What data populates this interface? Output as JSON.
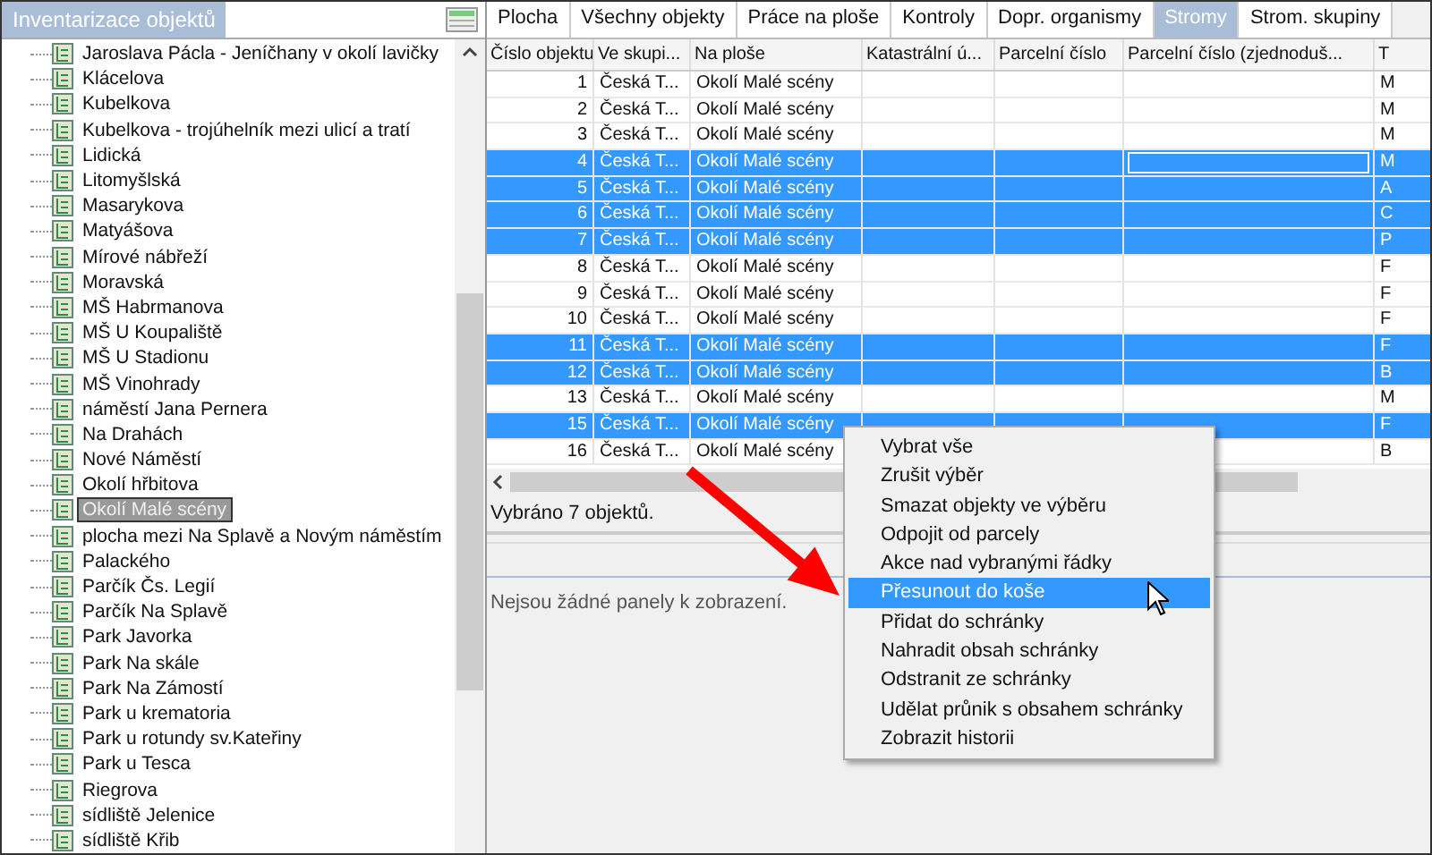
{
  "left_panel": {
    "title": "Inventarizace objektů",
    "tree_items": [
      {
        "label": "Jaroslava Pácla - Jeníčhany v okolí lavičky",
        "selected": false
      },
      {
        "label": "Klácelova",
        "selected": false
      },
      {
        "label": "Kubelkova",
        "selected": false
      },
      {
        "label": "Kubelkova - trojúhelník mezi ulicí a tratí",
        "selected": false
      },
      {
        "label": "Lidická",
        "selected": false
      },
      {
        "label": "Litomyšlská",
        "selected": false
      },
      {
        "label": "Masarykova",
        "selected": false
      },
      {
        "label": "Matyášova",
        "selected": false
      },
      {
        "label": "Mírové nábřeží",
        "selected": false
      },
      {
        "label": "Moravská",
        "selected": false
      },
      {
        "label": "MŠ Habrmanova",
        "selected": false
      },
      {
        "label": "MŠ U Koupaliště",
        "selected": false
      },
      {
        "label": "MŠ U Stadionu",
        "selected": false
      },
      {
        "label": "MŠ Vinohrady",
        "selected": false
      },
      {
        "label": "náměstí Jana Pernera",
        "selected": false
      },
      {
        "label": "Na Drahách",
        "selected": false
      },
      {
        "label": "Nové Náměstí",
        "selected": false
      },
      {
        "label": "Okolí hřbitova",
        "selected": false
      },
      {
        "label": "Okolí Malé scény",
        "selected": true
      },
      {
        "label": "plocha mezi Na Splavě a Novým náměstím",
        "selected": false
      },
      {
        "label": "Palackého",
        "selected": false
      },
      {
        "label": "Parčík Čs. Legií",
        "selected": false
      },
      {
        "label": "Parčík Na Splavě",
        "selected": false
      },
      {
        "label": "Park Javorka",
        "selected": false
      },
      {
        "label": "Park Na skále",
        "selected": false
      },
      {
        "label": "Park Na Zámostí",
        "selected": false
      },
      {
        "label": "Park u krematoria",
        "selected": false
      },
      {
        "label": "Park u rotundy sv.Kateřiny",
        "selected": false
      },
      {
        "label": "Park u Tesca",
        "selected": false
      },
      {
        "label": "Riegrova",
        "selected": false
      },
      {
        "label": "sídliště Jelenice",
        "selected": false
      },
      {
        "label": "sídliště Křib",
        "selected": false
      }
    ]
  },
  "tabs": [
    {
      "label": "Plocha",
      "selected": false
    },
    {
      "label": "Všechny objekty",
      "selected": false
    },
    {
      "label": "Práce na ploše",
      "selected": false
    },
    {
      "label": "Kontroly",
      "selected": false
    },
    {
      "label": "Dopr. organismy",
      "selected": false
    },
    {
      "label": "Stromy",
      "selected": true
    },
    {
      "label": "Strom. skupiny",
      "selected": false
    }
  ],
  "table": {
    "columns": [
      "Číslo objektu",
      "Ve skupi...",
      "Na ploše",
      "Katastrální ú...",
      "Parcelní číslo",
      "Parcelní číslo (zjednoduš...",
      "T"
    ],
    "rows": [
      {
        "cells": [
          "1",
          "Česká T...",
          "Okolí Malé scény",
          "",
          "",
          "",
          "M"
        ],
        "selected": false
      },
      {
        "cells": [
          "2",
          "Česká T...",
          "Okolí Malé scény",
          "",
          "",
          "",
          "M"
        ],
        "selected": false
      },
      {
        "cells": [
          "3",
          "Česká T...",
          "Okolí Malé scény",
          "",
          "",
          "",
          "M"
        ],
        "selected": false
      },
      {
        "cells": [
          "4",
          "Česká T...",
          "Okolí Malé scény",
          "",
          "",
          "",
          "M"
        ],
        "selected": true,
        "editing": true
      },
      {
        "cells": [
          "5",
          "Česká T...",
          "Okolí Malé scény",
          "",
          "",
          "",
          "A"
        ],
        "selected": true
      },
      {
        "cells": [
          "6",
          "Česká T...",
          "Okolí Malé scény",
          "",
          "",
          "",
          "C"
        ],
        "selected": true
      },
      {
        "cells": [
          "7",
          "Česká T...",
          "Okolí Malé scény",
          "",
          "",
          "",
          "P"
        ],
        "selected": true
      },
      {
        "cells": [
          "8",
          "Česká T...",
          "Okolí Malé scény",
          "",
          "",
          "",
          "F"
        ],
        "selected": false
      },
      {
        "cells": [
          "9",
          "Česká T...",
          "Okolí Malé scény",
          "",
          "",
          "",
          "F"
        ],
        "selected": false
      },
      {
        "cells": [
          "10",
          "Česká T...",
          "Okolí Malé scény",
          "",
          "",
          "",
          "F"
        ],
        "selected": false
      },
      {
        "cells": [
          "11",
          "Česká T...",
          "Okolí Malé scény",
          "",
          "",
          "",
          "F"
        ],
        "selected": true
      },
      {
        "cells": [
          "12",
          "Česká T...",
          "Okolí Malé scény",
          "",
          "",
          "",
          "B"
        ],
        "selected": true
      },
      {
        "cells": [
          "13",
          "Česká T...",
          "Okolí Malé scény",
          "",
          "",
          "",
          "M"
        ],
        "selected": false
      },
      {
        "cells": [
          "15",
          "Česká T...",
          "Okolí Malé scény",
          "",
          "",
          "",
          "F"
        ],
        "selected": true
      },
      {
        "cells": [
          "16",
          "Česká T...",
          "Okolí Malé scény",
          "",
          "",
          "",
          "B"
        ],
        "selected": false
      }
    ]
  },
  "status": "Vybráno 7 objektů.",
  "panels_message": "Nejsou žádné panely k zobrazení.",
  "context_menu": [
    {
      "label": "Vybrat vše",
      "selected": false
    },
    {
      "label": "Zrušit výběr",
      "selected": false
    },
    {
      "label": "Smazat objekty ve výběru",
      "selected": false
    },
    {
      "label": "Odpojit od parcely",
      "selected": false
    },
    {
      "label": "Akce nad vybranými řádky",
      "selected": false
    },
    {
      "label": "Přesunout do koše",
      "selected": true
    },
    {
      "label": "Přidat do schránky",
      "selected": false
    },
    {
      "label": "Nahradit obsah schránky",
      "selected": false
    },
    {
      "label": "Odstranit ze schránky",
      "selected": false
    },
    {
      "label": "Udělat průnik s obsahem schránky",
      "selected": false
    },
    {
      "label": "Zobrazit historii",
      "selected": false
    }
  ]
}
